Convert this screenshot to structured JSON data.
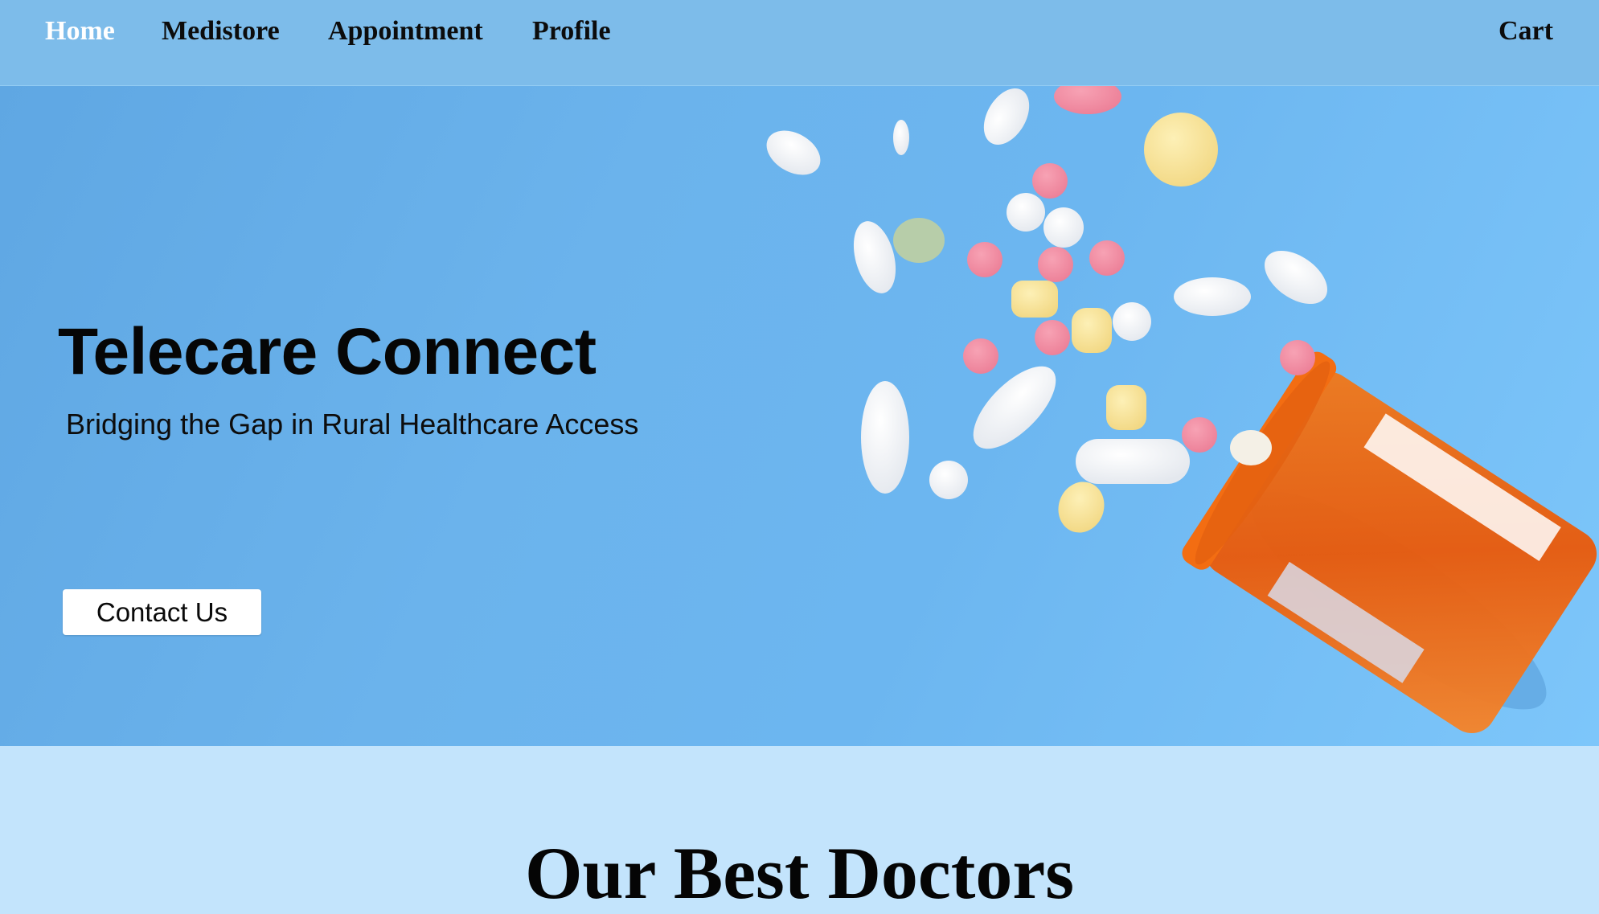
{
  "nav": {
    "items": [
      {
        "label": "Home",
        "active": true
      },
      {
        "label": "Medistore",
        "active": false
      },
      {
        "label": "Appointment",
        "active": false
      },
      {
        "label": "Profile",
        "active": false
      }
    ],
    "cart_label": "Cart"
  },
  "hero": {
    "title": "Telecare Connect",
    "subtitle": "Bridging the Gap in Rural Healthcare Access",
    "cta_label": "Contact Us",
    "image": "pills spilling from orange prescription bottle on blue background"
  },
  "section": {
    "title": "Our Best Doctors"
  },
  "colors": {
    "nav_bg": "#7dbcea",
    "hero_bg": "#6cb2ec",
    "page_bg": "#c3e4fc",
    "active_link": "#ffffff"
  }
}
